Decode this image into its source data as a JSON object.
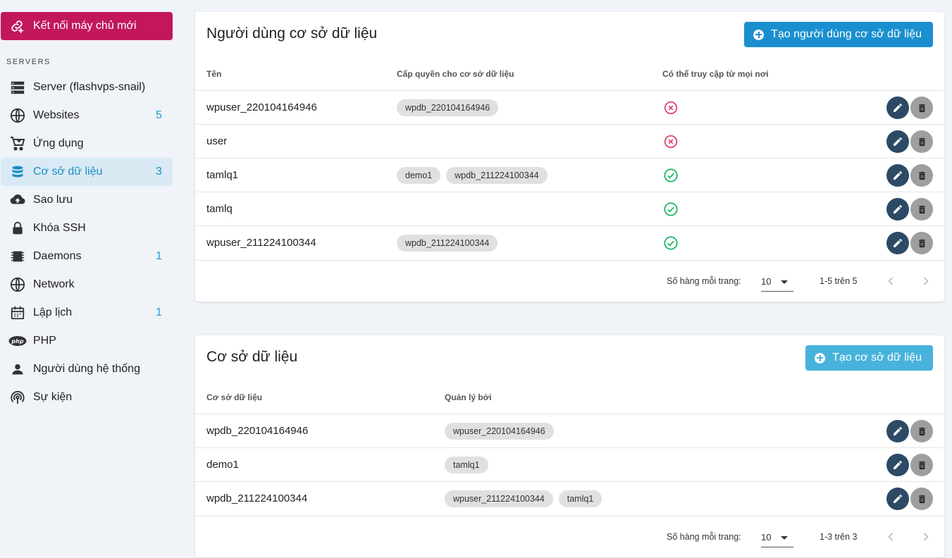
{
  "sidebar": {
    "connect_label": "Kết nối máy chủ mới",
    "servers_heading": "SERVERS",
    "items": [
      {
        "label": "Server (flashvps-snail)",
        "count": "",
        "icon": "server-icon"
      },
      {
        "label": "Websites",
        "count": "5",
        "icon": "globe-icon"
      },
      {
        "label": "Ứng dụng",
        "count": "",
        "icon": "cart-icon"
      },
      {
        "label": "Cơ sở dữ liệu",
        "count": "3",
        "icon": "database-icon",
        "active": true
      },
      {
        "label": "Sao lưu",
        "count": "",
        "icon": "cloud-upload-icon"
      },
      {
        "label": "Khóa SSH",
        "count": "",
        "icon": "lock-icon"
      },
      {
        "label": "Daemons",
        "count": "1",
        "icon": "chip-icon"
      },
      {
        "label": "Network",
        "count": "",
        "icon": "globe-icon"
      },
      {
        "label": "Lập lịch",
        "count": "1",
        "icon": "calendar-icon"
      },
      {
        "label": "PHP",
        "count": "",
        "icon": "php-icon"
      },
      {
        "label": "Người dùng hệ thống",
        "count": "",
        "icon": "person-icon"
      },
      {
        "label": "Sự kiện",
        "count": "",
        "icon": "broadcast-icon"
      }
    ]
  },
  "users_card": {
    "title": "Người dùng cơ sở dữ liệu",
    "create_label": "Tạo người dùng cơ sở dữ liệu",
    "headers": [
      "Tên",
      "Cấp quyền cho cơ sở dữ liệu",
      "Có thể truy cập từ mọi nơi"
    ],
    "rows": [
      {
        "name": "wpuser_220104164946",
        "grants": [
          "wpdb_220104164946"
        ],
        "remote": false
      },
      {
        "name": "user",
        "grants": [],
        "remote": false
      },
      {
        "name": "tamlq1",
        "grants": [
          "demo1",
          "wpdb_211224100344"
        ],
        "remote": true
      },
      {
        "name": "tamlq",
        "grants": [],
        "remote": true
      },
      {
        "name": "wpuser_211224100344",
        "grants": [
          "wpdb_211224100344"
        ],
        "remote": true
      }
    ],
    "footer": {
      "rows_per_page_label": "Số hàng mỗi trang:",
      "rows_per_page": "10",
      "range": "1-5 trên 5"
    }
  },
  "db_card": {
    "title": "Cơ sở dữ liệu",
    "create_label": "Tạo cơ sở dữ liệu",
    "headers": [
      "Cơ sở dữ liệu",
      "Quản lý bởi"
    ],
    "rows": [
      {
        "name": "wpdb_220104164946",
        "managers": [
          "wpuser_220104164946"
        ]
      },
      {
        "name": "demo1",
        "managers": [
          "tamlq1"
        ]
      },
      {
        "name": "wpdb_211224100344",
        "managers": [
          "wpuser_211224100344",
          "tamlq1"
        ]
      }
    ],
    "footer": {
      "rows_per_page_label": "Số hàng mỗi trang:",
      "rows_per_page": "10",
      "range": "1-3 trên 3"
    }
  },
  "colors": {
    "accent_pink": "#c2185b",
    "accent_blue": "#1a8fcf",
    "accent_blue_light": "#47b3dc",
    "status_ok": "#21b86b",
    "status_no": "#e0456c",
    "edit_button": "#2c4a66",
    "delete_button": "#9e9e9e"
  }
}
